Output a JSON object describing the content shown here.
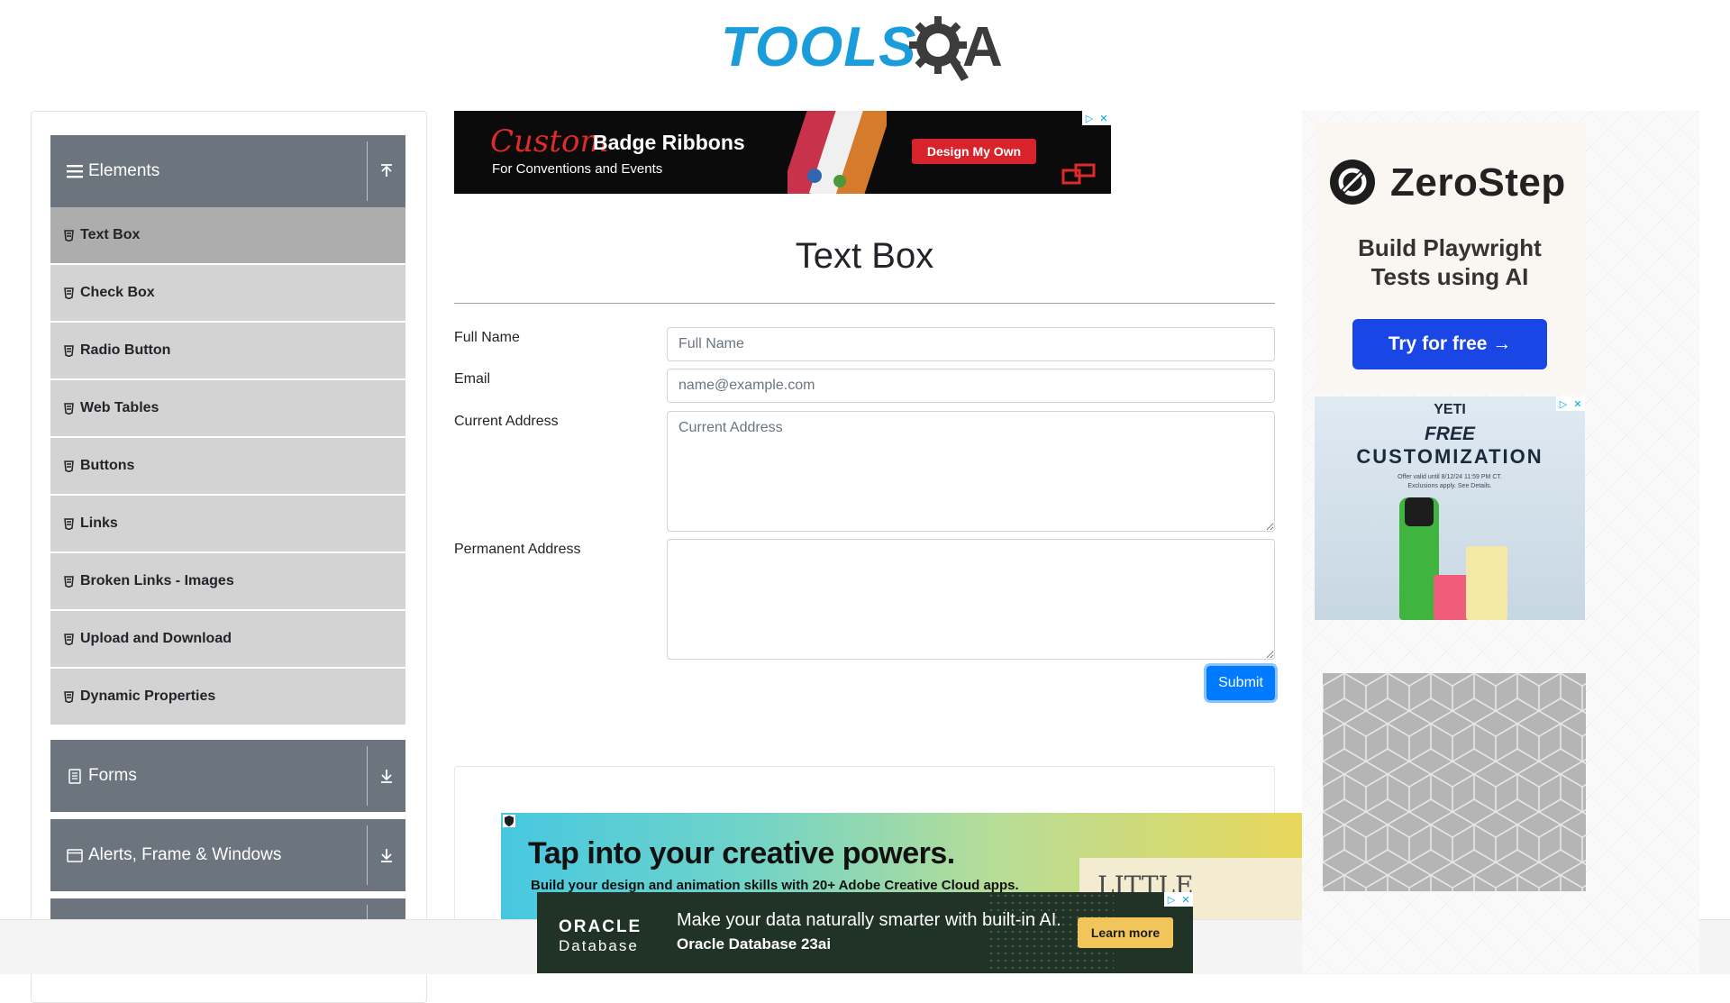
{
  "logo": {
    "text_left": "TOOLS",
    "text_right": "A"
  },
  "sidebar": {
    "elements_group": {
      "label": "Elements",
      "icon": "hamburger-icon",
      "arrow": "collapse-up-icon"
    },
    "items": [
      {
        "label": "Text Box",
        "active": true
      },
      {
        "label": "Check Box",
        "active": false
      },
      {
        "label": "Radio Button",
        "active": false
      },
      {
        "label": "Web Tables",
        "active": false
      },
      {
        "label": "Buttons",
        "active": false
      },
      {
        "label": "Links",
        "active": false
      },
      {
        "label": "Broken Links - Images",
        "active": false
      },
      {
        "label": "Upload and Download",
        "active": false
      },
      {
        "label": "Dynamic Properties",
        "active": false
      }
    ],
    "forms_group": {
      "label": "Forms",
      "icon": "document-icon",
      "arrow": "expand-down-icon"
    },
    "alerts_group": {
      "label": "Alerts, Frame & Windows",
      "icon": "window-icon",
      "arrow": "expand-down-icon"
    }
  },
  "ad_top": {
    "script_word": "Custom",
    "headline": "Badge Ribbons",
    "subline": "For Conventions and Events",
    "button": "Design My Own"
  },
  "main": {
    "title": "Text Box",
    "full_name": {
      "label": "Full Name",
      "placeholder": "Full Name",
      "value": ""
    },
    "email": {
      "label": "Email",
      "placeholder": "name@example.com",
      "value": ""
    },
    "current_address": {
      "label": "Current Address",
      "placeholder": "Current Address",
      "value": ""
    },
    "permanent_address": {
      "label": "Permanent Address",
      "placeholder": "",
      "value": ""
    },
    "submit_label": "Submit"
  },
  "ad_adobe": {
    "headline": "Tap into your creative powers.",
    "tagline": "Build your design and animation skills with 20+ Adobe Creative Cloud apps.",
    "book_text": "LITTLE"
  },
  "ad_oracle": {
    "brand": "ORACLE",
    "product": "Database",
    "line1": "Make your data naturally smarter with built-in AI.",
    "line2": "Oracle Database 23ai",
    "button": "Learn more"
  },
  "ad_zerostep": {
    "name": "ZeroStep",
    "tagline_1": "Build Playwright",
    "tagline_2": "Tests using AI",
    "button": "Try for free →"
  },
  "ad_yeti": {
    "brand": "YETI",
    "free": "FREE",
    "headline": "CUSTOMIZATION",
    "fine_1": "Offer valid until 8/12/24 11:59 PM CT.",
    "fine_2": "Exclusions apply. See Details."
  },
  "colors": {
    "accent_blue": "#007bff",
    "sidebar_header": "#6c757d",
    "menu_item": "#d3d3d3",
    "menu_item_active": "#adadad",
    "logo_blue": "#1b9ddc"
  }
}
